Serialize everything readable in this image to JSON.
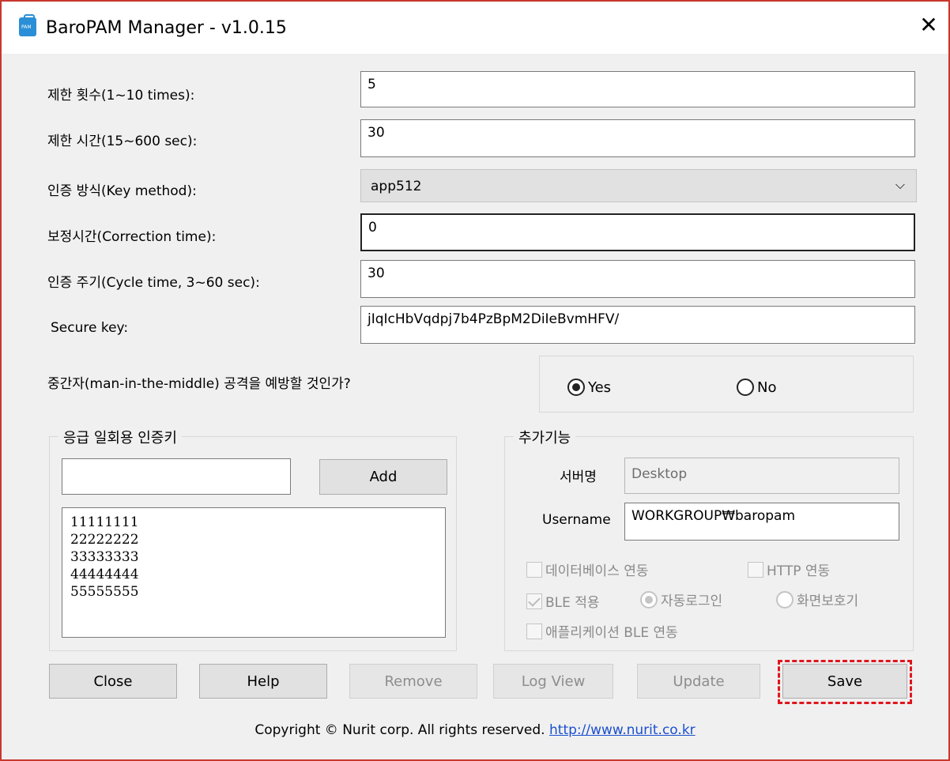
{
  "window": {
    "title": "BaroPAM Manager - v1.0.15",
    "close_glyph": "✕",
    "icon_text": "PAM"
  },
  "settings": {
    "limit_count": {
      "label": "제한 횟수(1~10 times):",
      "value": "5"
    },
    "limit_time": {
      "label": "제한 시간(15~600 sec):",
      "value": "30"
    },
    "key_method": {
      "label": "인증 방식(Key method):",
      "value": "app512"
    },
    "correction_time": {
      "label": "보정시간(Correction time):",
      "value": "0"
    },
    "cycle_time": {
      "label": "인증 주기(Cycle time, 3~60 sec):",
      "value": "30"
    },
    "secure_key": {
      "label": "Secure key:",
      "value": "jIqIcHbVqdpj7b4PzBpM2DiIeBvmHFV/"
    }
  },
  "mitm": {
    "question": "중간자(man-in-the-middle) 공격을 예방할 것인가?",
    "yes_label": "Yes",
    "no_label": "No",
    "selected": "Yes"
  },
  "emergency": {
    "title": "응급 일회용 인증키",
    "input_value": "",
    "add_label": "Add",
    "keys": [
      "11111111",
      "22222222",
      "33333333",
      "44444444",
      "55555555"
    ]
  },
  "extra": {
    "title": "추가기능",
    "server_label": "서버명",
    "server_value": "Desktop",
    "username_label": "Username",
    "username_value": "WORKGROUP₩baropam",
    "db_link": "데이터베이스 연동",
    "http_link": "HTTP 연동",
    "ble_apply": "BLE 적용",
    "auto_login": "자동로그인",
    "screensaver": "화면보호기",
    "app_ble": "애플리케이션 BLE 연동"
  },
  "buttons": {
    "close": "Close",
    "help": "Help",
    "remove": "Remove",
    "log_view": "Log View",
    "update": "Update",
    "save": "Save"
  },
  "footer": {
    "copyright": "Copyright © Nurit corp. All rights reserved.",
    "link": "http://www.nurit.co.kr"
  },
  "colors": {
    "highlight": "#e0161e",
    "window_border": "#c8382e",
    "link": "#1a4fcf"
  }
}
